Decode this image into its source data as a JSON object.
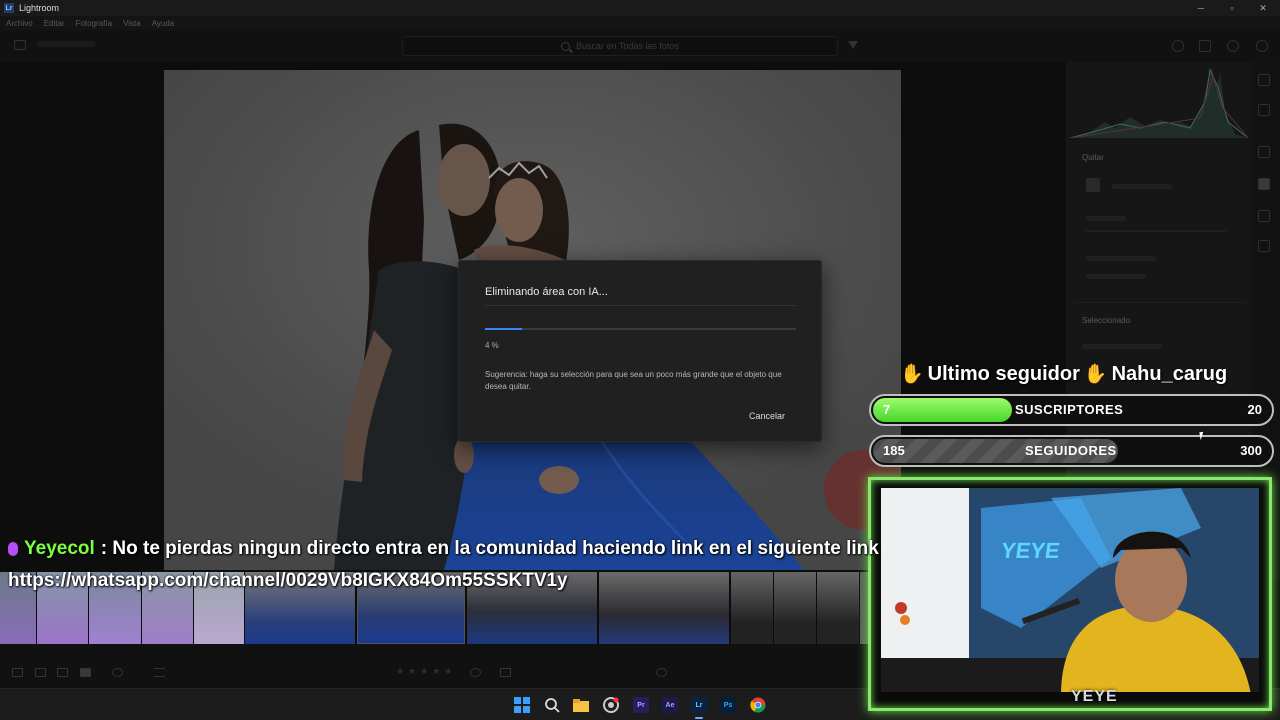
{
  "window": {
    "title": "Lightroom",
    "badge": "Lr"
  },
  "menu": [
    "Archivo",
    "Editar",
    "Fotografía",
    "Vista",
    "Ayuda"
  ],
  "search": {
    "placeholder": "Buscar en Todas las fotos"
  },
  "right_panel": {
    "remove_label": "Quitar",
    "selected_label": "Seleccionado"
  },
  "modal": {
    "title": "Eliminando área con IA...",
    "progress": 0.04,
    "progress_text": "4 %",
    "hint": "Sugerencia: haga su selección para que sea un poco más grande que el objeto que desea quitar.",
    "cancel_label": "Cancelar"
  },
  "overlay": {
    "last_follower_label": "Ultimo seguidor",
    "last_follower_name": "Nahu_carug",
    "subscribers": {
      "label": "SUSCRIPTORES",
      "current": "7",
      "goal": "20"
    },
    "followers": {
      "label": "SEGUIDORES",
      "current": "185",
      "goal": "300"
    },
    "cam_logo": "YEYE",
    "cam_sign": "YEYE"
  },
  "chat": {
    "user": "Yeyecol",
    "message": ": No te pierdas ningun directo entra en la comunidad haciendo link en el siguiente link",
    "link": "https://whatsapp.com/channel/0029Vb8IGKX84Om55SSKTV1y"
  },
  "taskbar": {
    "apps": [
      "windows-start",
      "search",
      "file-explorer",
      "chrome-canary",
      "premiere-pro",
      "after-effects",
      "lightroom",
      "photoshop",
      "chrome"
    ]
  },
  "colors": {
    "accent": "#3b86f7",
    "overlay_green": "#6cdc4a",
    "chat_user": "#7cff3f"
  }
}
